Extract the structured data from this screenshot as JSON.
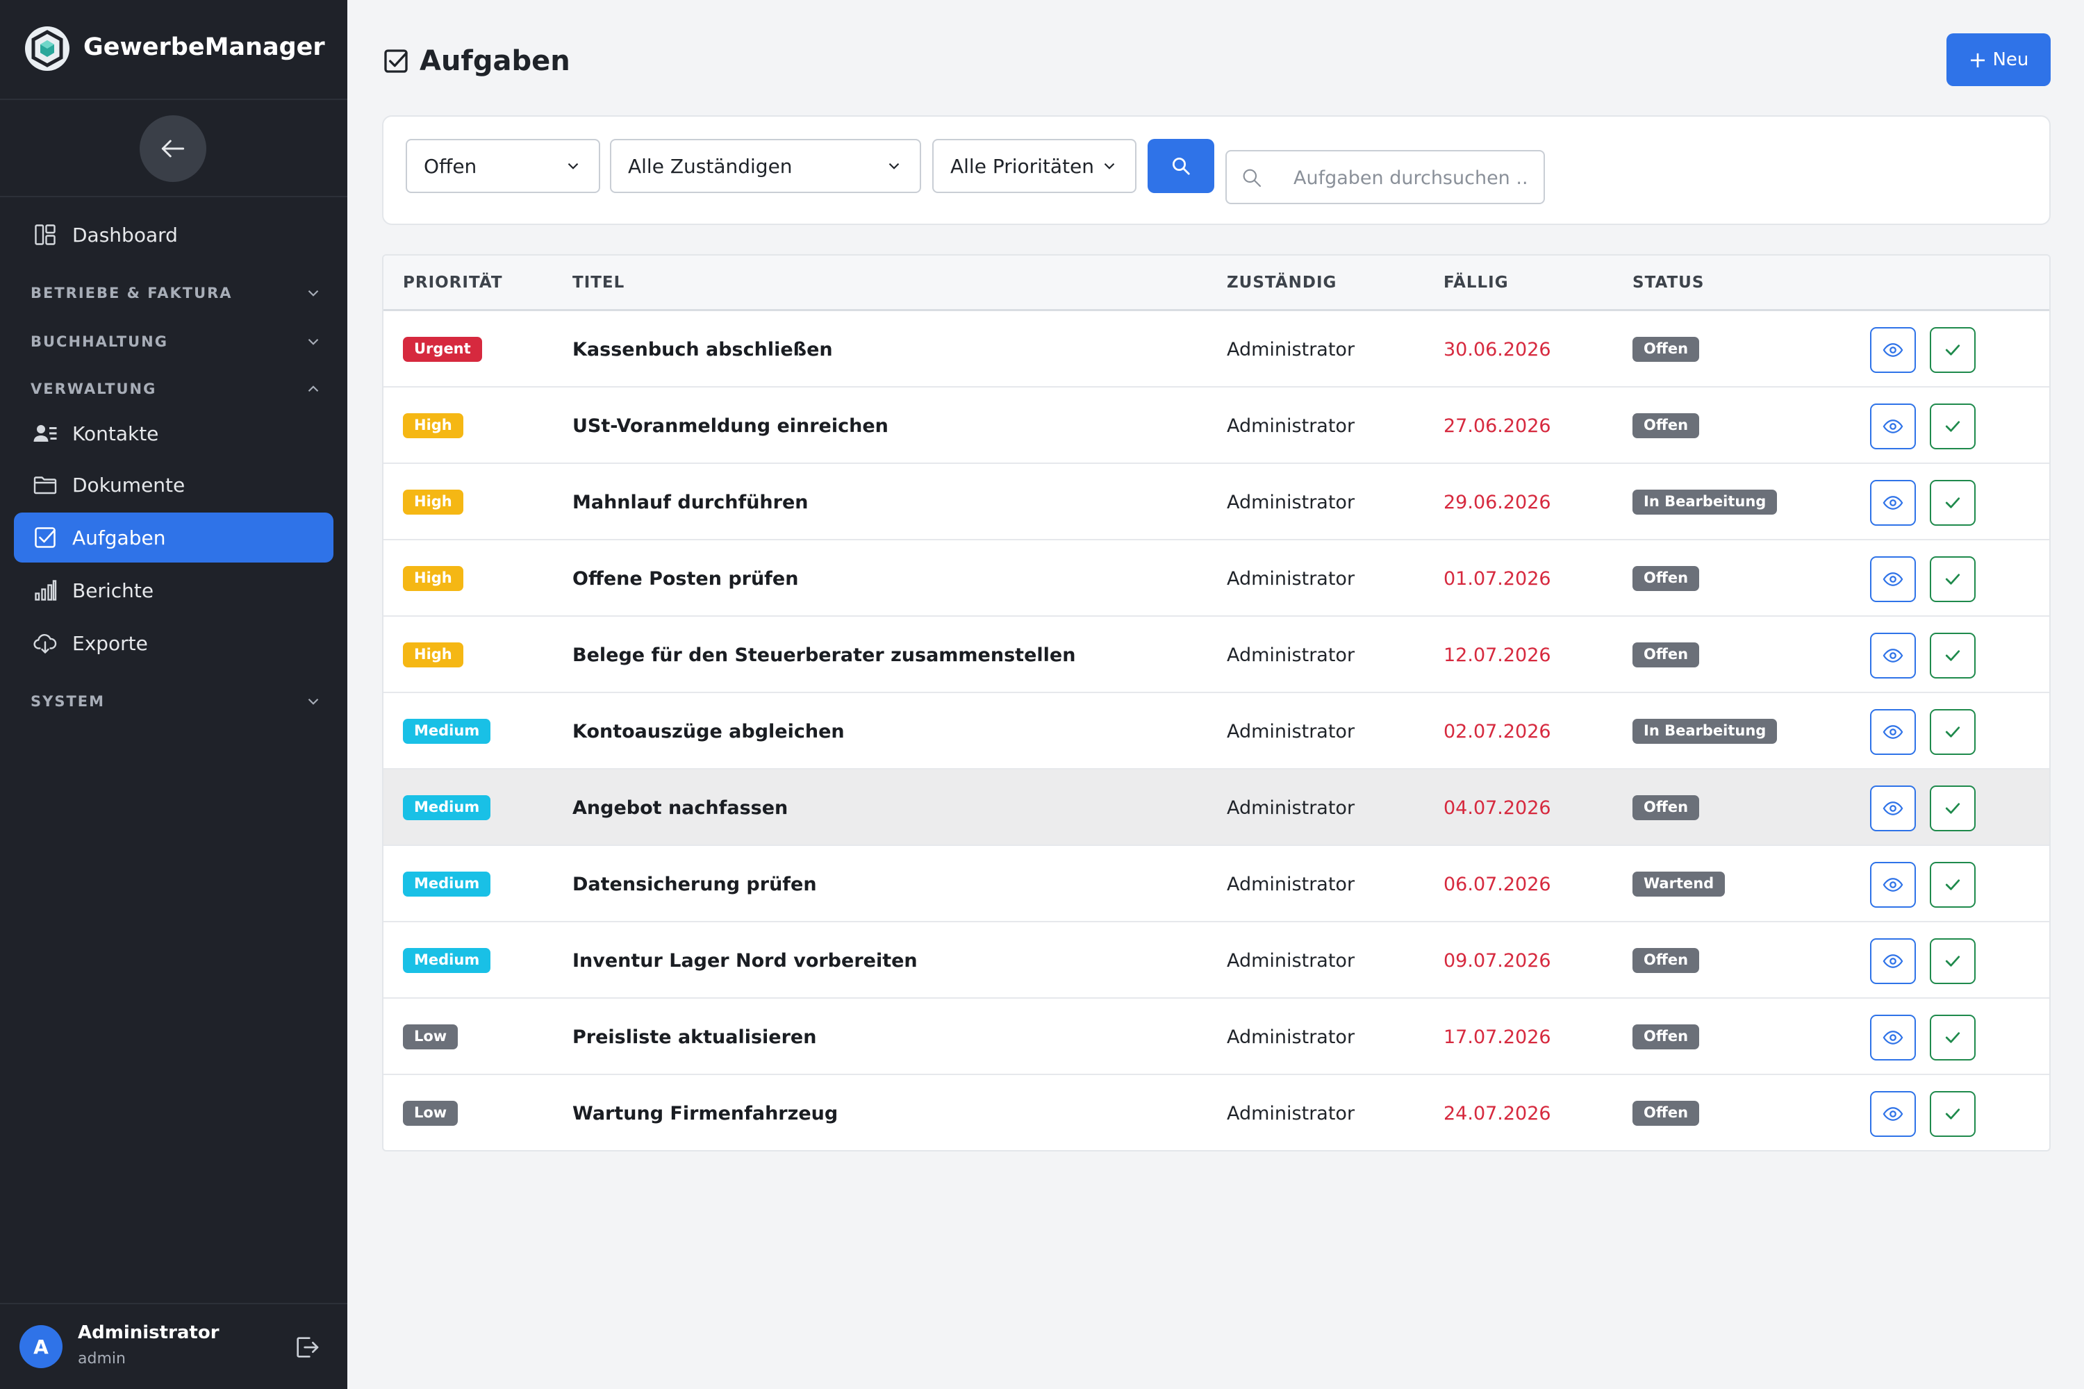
{
  "app": {
    "name": "GewerbeManager",
    "logo_icon": "hexagon-cube-logo"
  },
  "sidebar": {
    "collapse_icon": "arrow-left-icon",
    "items": [
      {
        "label": "Dashboard",
        "icon": "dashboard-icon"
      },
      {
        "label": "Kontakte",
        "icon": "contacts-icon"
      },
      {
        "label": "Dokumente",
        "icon": "folder-icon"
      },
      {
        "label": "Aufgaben",
        "icon": "checkbox-icon",
        "active": true
      },
      {
        "label": "Berichte",
        "icon": "bar-chart-icon"
      },
      {
        "label": "Exporte",
        "icon": "cloud-download-icon"
      }
    ],
    "sections": [
      {
        "label": "BETRIEBE & FAKTURA",
        "expanded": false
      },
      {
        "label": "BUCHHALTUNG",
        "expanded": false
      },
      {
        "label": "VERWALTUNG",
        "expanded": true
      },
      {
        "label": "SYSTEM",
        "expanded": false
      }
    ],
    "user": {
      "initial": "A",
      "name": "Administrator",
      "login": "admin"
    }
  },
  "header": {
    "title": "Aufgaben",
    "new_button": "Neu"
  },
  "filters": {
    "status": "Offen",
    "assignee": "Alle Zuständigen",
    "priority": "Alle Prioritäten",
    "search_placeholder": "Aufgaben durchsuchen ..."
  },
  "table": {
    "columns": [
      "PRIORITÄT",
      "TITEL",
      "ZUSTÄNDIG",
      "FÄLLIG",
      "STATUS"
    ],
    "rows": [
      {
        "priority": "Urgent",
        "title": "Kassenbuch abschließen",
        "assignee": "Administrator",
        "due": "30.06.2026",
        "status": "Offen"
      },
      {
        "priority": "High",
        "title": "USt-Voranmeldung einreichen",
        "assignee": "Administrator",
        "due": "27.06.2026",
        "status": "Offen"
      },
      {
        "priority": "High",
        "title": "Mahnlauf durchführen",
        "assignee": "Administrator",
        "due": "29.06.2026",
        "status": "In Bearbeitung"
      },
      {
        "priority": "High",
        "title": "Offene Posten prüfen",
        "assignee": "Administrator",
        "due": "01.07.2026",
        "status": "Offen"
      },
      {
        "priority": "High",
        "title": "Belege für den Steuerberater zusammenstellen",
        "assignee": "Administrator",
        "due": "12.07.2026",
        "status": "Offen"
      },
      {
        "priority": "Medium",
        "title": "Kontoauszüge abgleichen",
        "assignee": "Administrator",
        "due": "02.07.2026",
        "status": "In Bearbeitung"
      },
      {
        "priority": "Medium",
        "title": "Angebot nachfassen",
        "assignee": "Administrator",
        "due": "04.07.2026",
        "status": "Offen"
      },
      {
        "priority": "Medium",
        "title": "Datensicherung prüfen",
        "assignee": "Administrator",
        "due": "06.07.2026",
        "status": "Wartend"
      },
      {
        "priority": "Medium",
        "title": "Inventur Lager Nord vorbereiten",
        "assignee": "Administrator",
        "due": "09.07.2026",
        "status": "Offen"
      },
      {
        "priority": "Low",
        "title": "Preisliste aktualisieren",
        "assignee": "Administrator",
        "due": "17.07.2026",
        "status": "Offen"
      },
      {
        "priority": "Low",
        "title": "Wartung Firmenfahrzeug",
        "assignee": "Administrator",
        "due": "24.07.2026",
        "status": "Offen"
      }
    ]
  },
  "colors": {
    "accent": "#2f73e8",
    "sidebar_bg": "#1f2229",
    "urgent": "#d6293e",
    "high": "#f5b714",
    "medium": "#19c0e6",
    "low": "#6b7079",
    "status": "#6b7079",
    "due_overdue": "#d6293e",
    "done_green": "#1f8a4c"
  }
}
